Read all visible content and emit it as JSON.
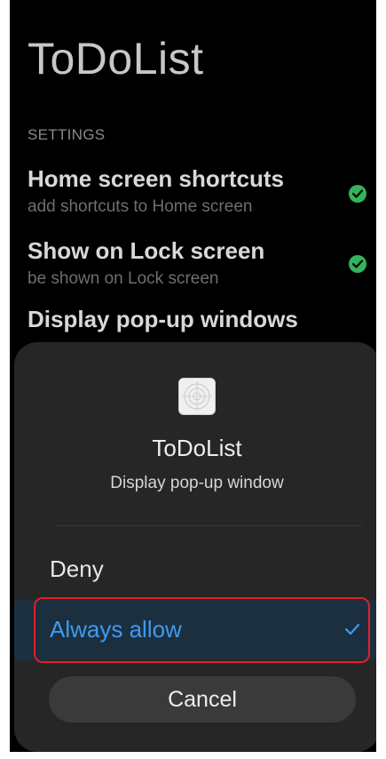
{
  "app": {
    "title": "ToDoList"
  },
  "settings": {
    "section_header": "SETTINGS",
    "items": [
      {
        "title": "Home screen shortcuts",
        "summary": "add shortcuts to Home screen",
        "checked": true
      },
      {
        "title": "Show on Lock screen",
        "summary": "be shown on Lock screen",
        "checked": true
      },
      {
        "title": "Display pop-up windows",
        "summary": "",
        "checked": false
      }
    ]
  },
  "dialog": {
    "app_name": "ToDoList",
    "subtitle": "Display pop-up window",
    "options": [
      {
        "label": "Deny",
        "selected": false
      },
      {
        "label": "Always allow",
        "selected": true
      }
    ],
    "cancel_label": "Cancel"
  },
  "colors": {
    "accent": "#3d9bf0",
    "check_green": "#34b35a",
    "annotation_red": "#e0202a"
  },
  "icons": {
    "check": "check-icon",
    "app": "app-icon"
  }
}
